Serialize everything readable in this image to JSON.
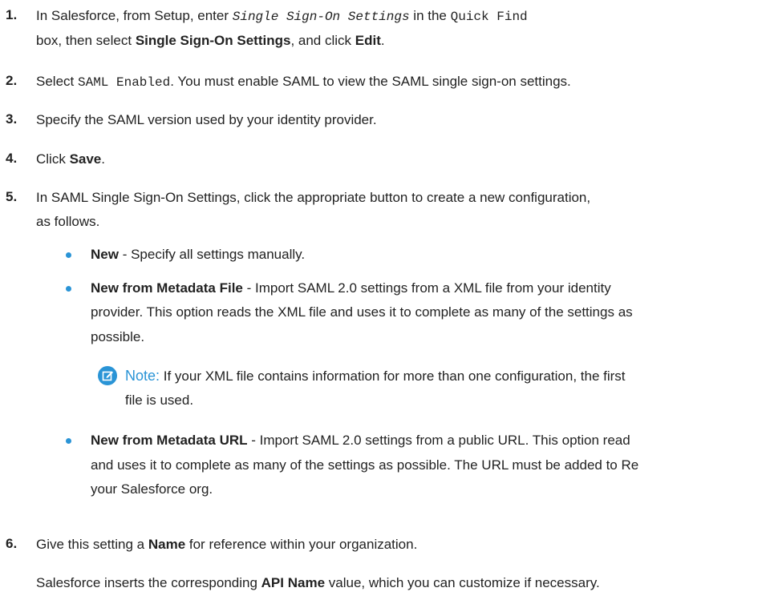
{
  "accent_color": "#2a94d6",
  "note_icon": "edit-note-icon",
  "steps": [
    {
      "num": "1.",
      "l1": "In Salesforce, from Setup, enter ",
      "code": "Single Sign-On Settings",
      "l1b": " in the ",
      "code2": "Quick Find",
      "l2a": "box, then select ",
      "bold1": "Single Sign-On Settings",
      "l2b": ", and click ",
      "bold2": "Edit",
      "l2c": "."
    },
    {
      "num": "2.",
      "a": "Select ",
      "code": "SAML Enabled",
      "b": ". You must enable SAML to view the SAML single sign-on settings."
    },
    {
      "num": "3.",
      "a": "Specify the SAML version used by your identity provider."
    },
    {
      "num": "4.",
      "a": "Click ",
      "bold": "Save",
      "b": "."
    },
    {
      "num": "5.",
      "l1": "In SAML Single Sign-On Settings, click the appropriate button to create a new configuration,",
      "l2": "as follows.",
      "bullets": [
        {
          "bold": "New",
          "l1": " - Specify all settings manually."
        },
        {
          "bold": "New from Metadata File",
          "l1": " - Import SAML 2.0 settings from a XML file from your identity",
          "l2": "provider. This option reads the XML file and uses it to complete as many of the settings as",
          "l3": "possible."
        },
        {
          "bold": "New from Metadata URL",
          "l1": " - Import SAML 2.0 settings from a public URL. This option read",
          "l2": "and uses it to complete as many of the settings as possible. The URL must be added to Re",
          "l3": "your Salesforce org."
        }
      ],
      "note": {
        "label": "Note:",
        "l1": " If your XML file contains information for more than one configuration, the first",
        "l2": "file is used."
      }
    },
    {
      "num": "6.",
      "a": "Give this setting a ",
      "bold": "Name",
      "b": " for reference within your organization.",
      "p_a": "Salesforce inserts the corresponding ",
      "p_bold": "API Name",
      "p_b": " value, which you can customize if necessary."
    }
  ]
}
